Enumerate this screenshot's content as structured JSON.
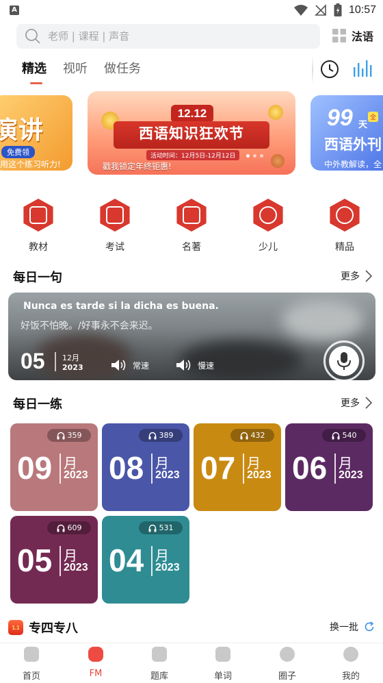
{
  "status_bar": {
    "time": "10:57",
    "left_badge": "A"
  },
  "search": {
    "placeholder": "老师 | 课程 | 声音"
  },
  "language": {
    "label": "法语"
  },
  "tabs": [
    {
      "label": "精选",
      "active": true
    },
    {
      "label": "视听",
      "active": false
    },
    {
      "label": "做任务",
      "active": false
    }
  ],
  "banners": {
    "left": {
      "title": "演讲",
      "tag": "免费领",
      "sub": "用这个练习听力!"
    },
    "main": {
      "top": "12.12",
      "title": "西语知识狂欢节",
      "date": "活动时间：12月5日-12月12日",
      "footer": "戳我锁定年终钜惠!"
    },
    "right": {
      "num": "99",
      "unit": "天",
      "title": "西语外刊",
      "badge": "全",
      "sub": "中外教解读，全"
    }
  },
  "categories": [
    {
      "label": "教材",
      "icon": "book-stack-icon"
    },
    {
      "label": "考试",
      "icon": "exam-paper-icon"
    },
    {
      "label": "名著",
      "icon": "open-book-icon"
    },
    {
      "label": "少儿",
      "icon": "child-face-icon"
    },
    {
      "label": "精品",
      "icon": "premium-music-icon"
    }
  ],
  "daily_sentence": {
    "title": "每日一句",
    "more": "更多",
    "french": "Nunca es tarde si la dicha es buena.",
    "chinese": "好饭不怕晚。/好事永不会来迟。",
    "day": "05",
    "month": "12月",
    "year": "2023",
    "normal_speed": "常速",
    "slow_speed": "慢速"
  },
  "daily_practice": {
    "title": "每日一练",
    "more": "更多",
    "month_word": "月",
    "cards": [
      {
        "month": "09",
        "year": "2023",
        "listens": "359",
        "color": "#b9787c"
      },
      {
        "month": "08",
        "year": "2023",
        "listens": "389",
        "color": "#4a56a8"
      },
      {
        "month": "07",
        "year": "2023",
        "listens": "432",
        "color": "#c98a12"
      },
      {
        "month": "06",
        "year": "2023",
        "listens": "540",
        "color": "#5c2a63"
      },
      {
        "month": "05",
        "year": "2023",
        "listens": "609",
        "color": "#732a52"
      },
      {
        "month": "04",
        "year": "2023",
        "listens": "531",
        "color": "#2f8c93"
      }
    ]
  },
  "section_48": {
    "icon_text": "1.1",
    "title": "专四专八",
    "swap": "换一批"
  },
  "bottom_nav": [
    {
      "label": "首页",
      "active": false
    },
    {
      "label": "FM",
      "active": true
    },
    {
      "label": "题库",
      "active": false
    },
    {
      "label": "单词",
      "active": false
    },
    {
      "label": "圈子",
      "active": false
    },
    {
      "label": "我的",
      "active": false
    }
  ],
  "colors": {
    "accent": "#e8624a",
    "nav_active": "#e8473a",
    "stats_icon": "#3aa0e8",
    "refresh_icon": "#3a8ee8"
  }
}
